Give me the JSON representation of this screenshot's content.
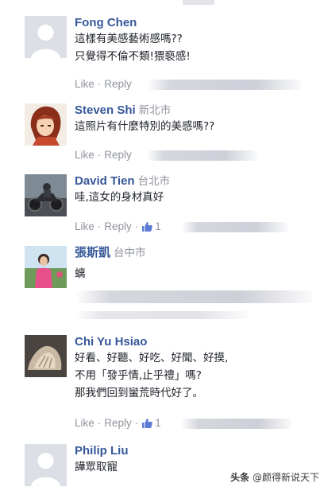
{
  "comments": [
    {
      "name": "Fong Chen",
      "location": "",
      "lines": [
        "這樣有美感藝術感嗎??",
        "只覺得不倫不類!猥褻感!"
      ],
      "like": "Like",
      "reply": "Reply",
      "likes": ""
    },
    {
      "name": "Steven Shi",
      "location": "新北市",
      "lines": [
        "這照片有什麼特別的美感嗎??"
      ],
      "like": "Like",
      "reply": "Reply",
      "likes": ""
    },
    {
      "name": "David Tien",
      "location": "台北市",
      "lines": [
        "哇,這女的身材真好"
      ],
      "like": "Like",
      "reply": "Reply",
      "likes": "1"
    },
    {
      "name": "張斯凱",
      "location": "台中市",
      "lines": [
        "螭"
      ],
      "like": "Like",
      "reply": "Reply",
      "likes": ""
    },
    {
      "name": "Chi Yu Hsiao",
      "location": "",
      "lines": [
        "好看、好聽、好吃、好聞、好摸,",
        "不用「發乎情,止乎禮」嗎?",
        "那我們回到蠻荒時代好了。"
      ],
      "like": "Like",
      "reply": "Reply",
      "likes": "1"
    },
    {
      "name": "Philip Liu",
      "location": "",
      "lines": [
        "譁眾取寵"
      ],
      "like": "",
      "reply": "",
      "likes": ""
    }
  ],
  "watermark": {
    "prefix": "头条",
    "handle": "@颜得新说天下"
  },
  "colors": {
    "name": "#365899",
    "meta": "#90949c",
    "text": "#1d2129"
  },
  "icons": [
    "thumbs-up-icon",
    "default-avatar-icon"
  ]
}
